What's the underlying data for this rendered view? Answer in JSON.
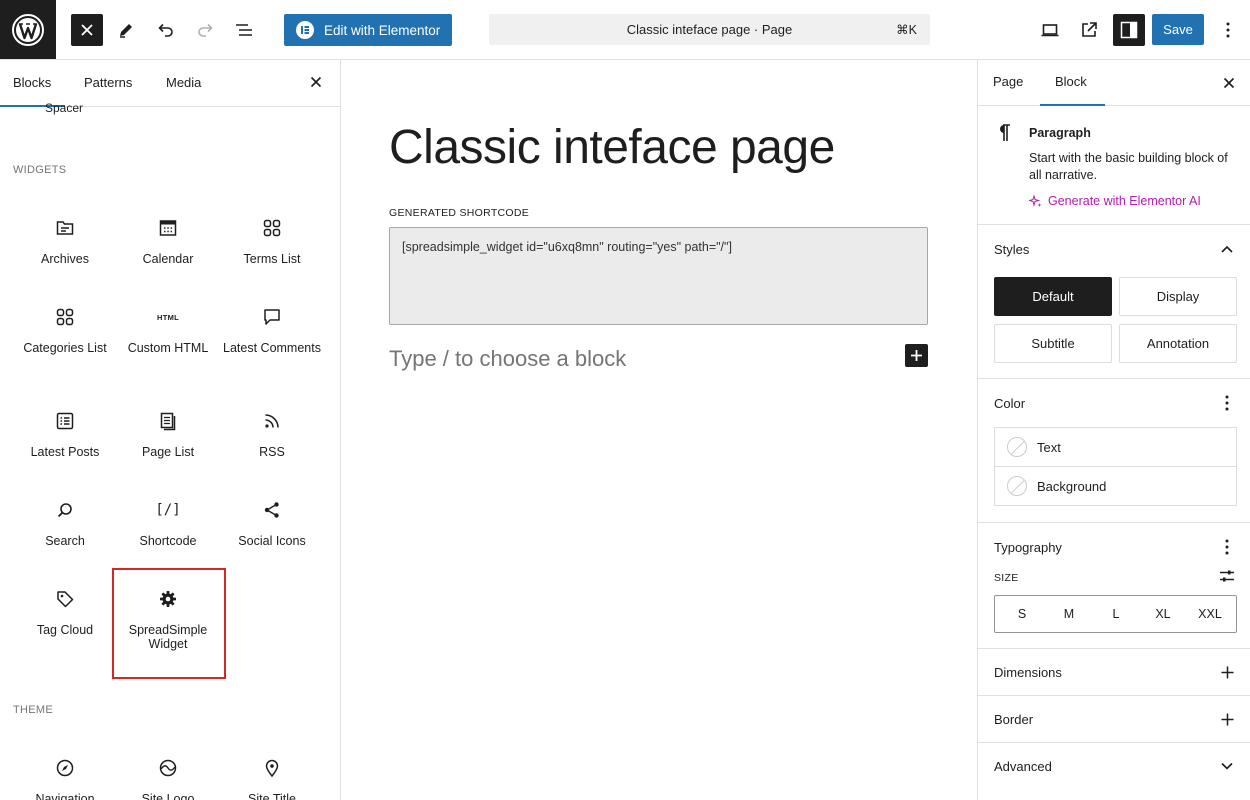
{
  "header": {
    "elementor_label": "Edit with Elementor",
    "document_title": "Classic inteface page · Page",
    "shortcut": "⌘K",
    "save_label": "Save"
  },
  "inserter": {
    "tabs": [
      "Blocks",
      "Patterns",
      "Media"
    ],
    "cutoff_item": "Spacer",
    "widgets_title": "WIDGETS",
    "widgets": [
      {
        "label": "Archives",
        "icon": "archive-icon"
      },
      {
        "label": "Calendar",
        "icon": "calendar-icon"
      },
      {
        "label": "Terms List",
        "icon": "grid-icon"
      },
      {
        "label": "Categories List",
        "icon": "grid-icon"
      },
      {
        "label": "Custom HTML",
        "icon": "html-icon"
      },
      {
        "label": "Latest Comments",
        "icon": "comment-icon"
      },
      {
        "label": "Latest Posts",
        "icon": "list-icon"
      },
      {
        "label": "Page List",
        "icon": "page-icon"
      },
      {
        "label": "RSS",
        "icon": "rss-icon"
      },
      {
        "label": "Search",
        "icon": "search-icon"
      },
      {
        "label": "Shortcode",
        "icon": "shortcode-icon"
      },
      {
        "label": "Social Icons",
        "icon": "share-icon"
      },
      {
        "label": "Tag Cloud",
        "icon": "tag-icon"
      },
      {
        "label": "SpreadSimple Widget",
        "icon": "gear-icon"
      }
    ],
    "html_icon_text": "HTML",
    "shortcode_icon_text": "[/]",
    "theme_title": "THEME",
    "theme": [
      {
        "label": "Navigation",
        "icon": "compass-icon"
      },
      {
        "label": "Site Logo",
        "icon": "site-logo-icon"
      },
      {
        "label": "Site Title",
        "icon": "map-pin-icon"
      }
    ]
  },
  "canvas": {
    "title": "Classic inteface page",
    "shortcode_label": "GENERATED SHORTCODE",
    "shortcode_value": "[spreadsimple_widget id=\"u6xq8mn\" routing=\"yes\" path=\"/\"]",
    "placeholder": "Type / to choose a block"
  },
  "sidebar": {
    "tabs": [
      "Page",
      "Block"
    ],
    "block_name": "Paragraph",
    "block_description": "Start with the basic building block of all narrative.",
    "ai_link": "Generate with Elementor AI",
    "styles_title": "Styles",
    "styles": [
      "Default",
      "Display",
      "Subtitle",
      "Annotation"
    ],
    "color_title": "Color",
    "colors": [
      "Text",
      "Background"
    ],
    "typography_title": "Typography",
    "size_label": "SIZE",
    "sizes": [
      "S",
      "M",
      "L",
      "XL",
      "XXL"
    ],
    "dimensions_title": "Dimensions",
    "border_title": "Border",
    "advanced_title": "Advanced"
  },
  "colors": {
    "accent": "#2271b1",
    "ai": "#b41cb3",
    "highlight": "#d42828",
    "dark": "#1e1e1e"
  }
}
